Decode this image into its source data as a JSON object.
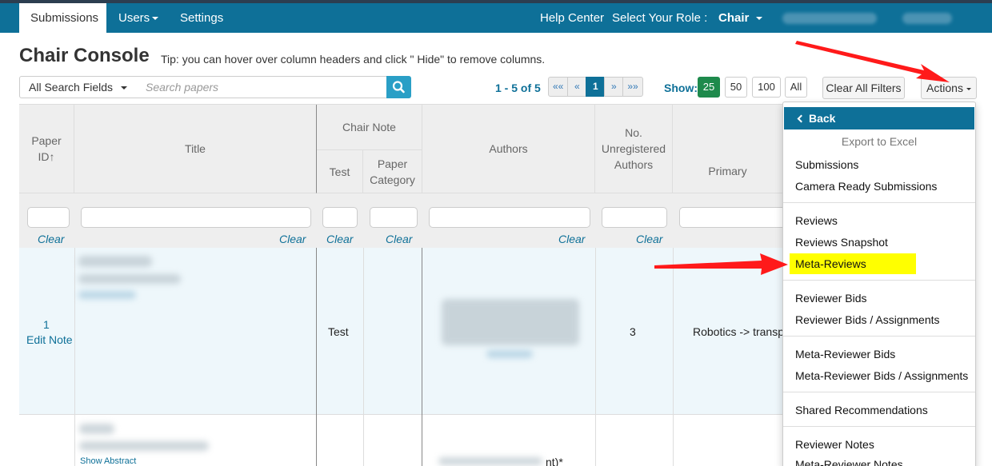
{
  "nav": {
    "tabs": [
      {
        "label": "Submissions"
      },
      {
        "label": "Users"
      },
      {
        "label": "Settings"
      }
    ],
    "help_center": "Help Center",
    "select_role_label": "Select Your Role :",
    "role": "Chair"
  },
  "header": {
    "title": "Chair Console",
    "tip": "Tip: you can hover over column headers and click \" Hide\" to remove columns."
  },
  "search": {
    "field_select": "All Search Fields",
    "placeholder": "Search papers"
  },
  "pager": {
    "info": "1 - 5 of 5",
    "buttons": [
      "««",
      "«",
      "1",
      "»",
      "»»"
    ]
  },
  "show": {
    "label": "Show:",
    "options": [
      "25",
      "50",
      "100",
      "All"
    ],
    "selected": "25"
  },
  "toolbar": {
    "clear_filters": "Clear All Filters",
    "actions": "Actions"
  },
  "table": {
    "headers": {
      "paper_id_line1": "Paper",
      "paper_id_line2": "ID↑",
      "title": "Title",
      "chair_note": "Chair Note",
      "test": "Test",
      "paper_category_line1": "Paper",
      "paper_category_line2": "Category",
      "authors": "Authors",
      "unregistered_line1": "No.",
      "unregistered_line2": "Unregistered",
      "unregistered_line3": "Authors",
      "primary": "Primary"
    },
    "clear_label": "Clear",
    "rows": [
      {
        "id": "1",
        "edit_note": "Edit Note",
        "test": "Test",
        "unregistered": "3",
        "primary": "Robotics -> transp"
      },
      {
        "show_abstract": "Show Abstract",
        "authors_tail": "nt)*"
      }
    ]
  },
  "actions_menu": {
    "back": "Back",
    "export_header": "Export to Excel",
    "groups": [
      [
        "Submissions",
        "Camera Ready Submissions"
      ],
      [
        "Reviews",
        "Reviews Snapshot",
        "Meta-Reviews"
      ],
      [
        "Reviewer Bids",
        "Reviewer Bids / Assignments"
      ],
      [
        "Meta-Reviewer Bids",
        "Meta-Reviewer Bids / Assignments"
      ],
      [
        "Shared Recommendations"
      ],
      [
        "Reviewer Notes",
        "Meta-Reviewer Notes"
      ]
    ],
    "highlighted": "Meta-Reviews",
    "highlight_color": "#ffff00"
  },
  "colors": {
    "brand": "#0e7098",
    "annotation_arrow": "#ff0000"
  }
}
